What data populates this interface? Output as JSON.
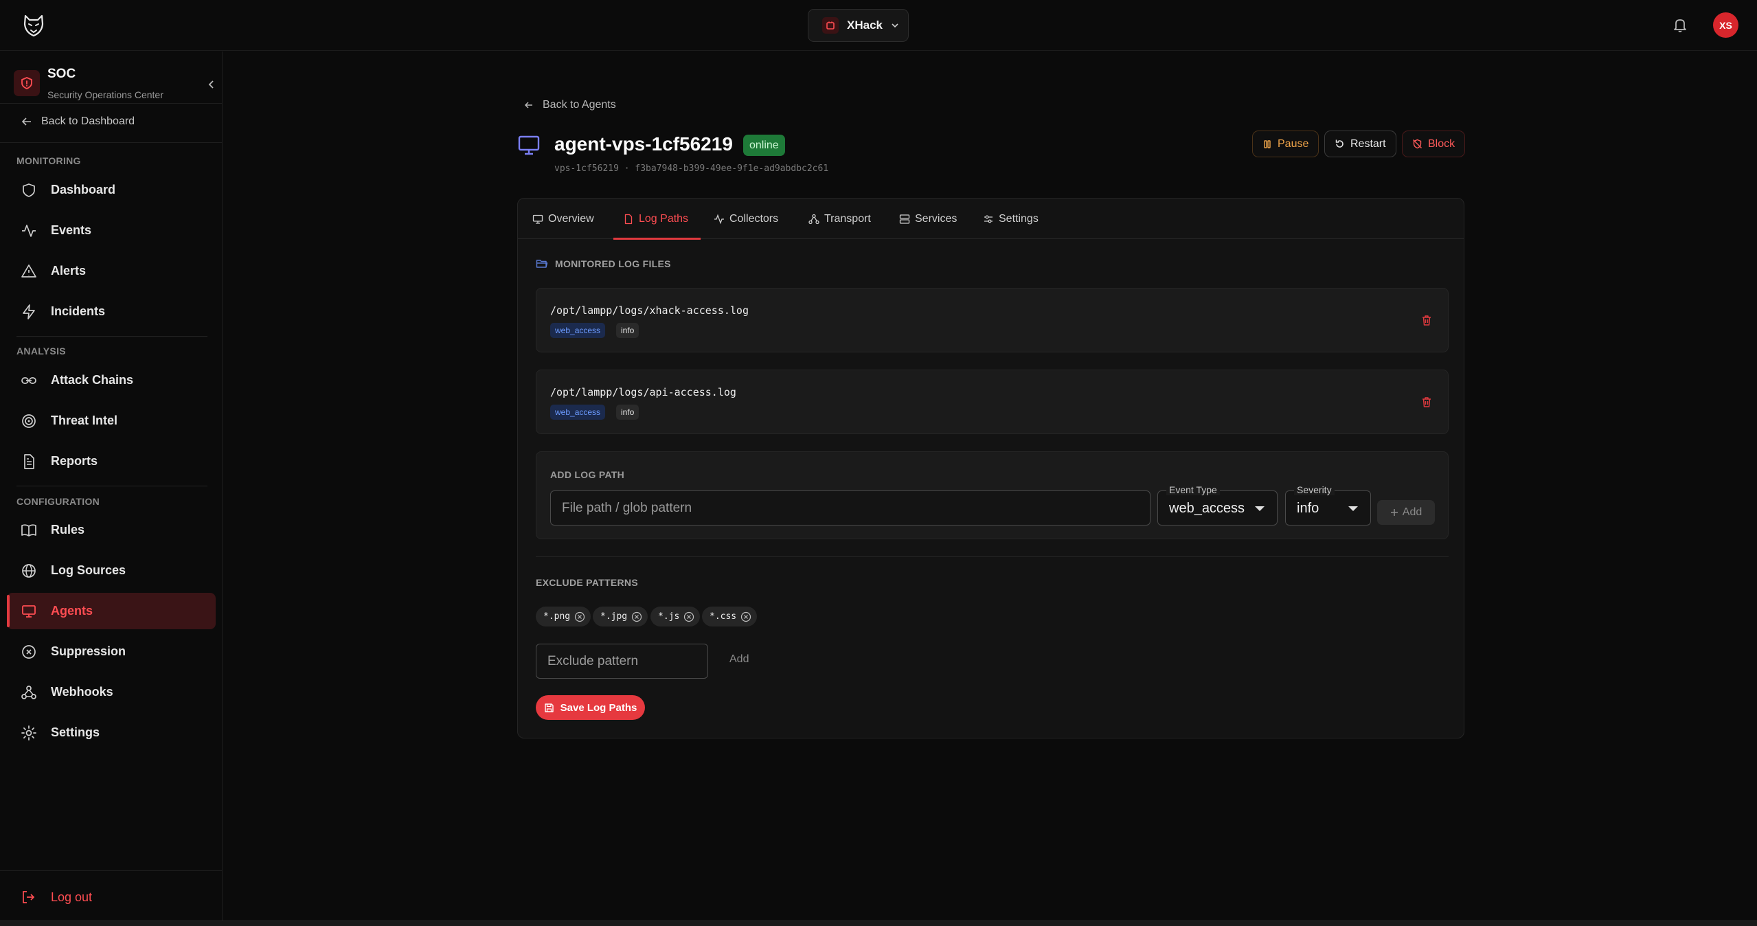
{
  "topbar": {
    "org_name": "XHack",
    "avatar_initials": "XS"
  },
  "sidebar": {
    "soc_title": "SOC",
    "soc_subtitle": "Security Operations Center",
    "back_label": "Back to Dashboard",
    "sections": {
      "monitoring": "MONITORING",
      "analysis": "ANALYSIS",
      "configuration": "CONFIGURATION"
    },
    "items": [
      {
        "label": "Dashboard",
        "icon": "shield-icon"
      },
      {
        "label": "Events",
        "icon": "activity-icon"
      },
      {
        "label": "Alerts",
        "icon": "warning-triangle-icon"
      },
      {
        "label": "Incidents",
        "icon": "zap-icon"
      },
      {
        "label": "Attack Chains",
        "icon": "link-icon"
      },
      {
        "label": "Threat Intel",
        "icon": "target-icon"
      },
      {
        "label": "Reports",
        "icon": "file-text-icon"
      },
      {
        "label": "Rules",
        "icon": "book-icon"
      },
      {
        "label": "Log Sources",
        "icon": "globe-icon"
      },
      {
        "label": "Agents",
        "icon": "monitor-icon",
        "active": true
      },
      {
        "label": "Suppression",
        "icon": "x-circle-icon"
      },
      {
        "label": "Webhooks",
        "icon": "webhook-icon"
      },
      {
        "label": "Settings",
        "icon": "gear-icon"
      }
    ],
    "logout_label": "Log out"
  },
  "agent": {
    "back_label": "Back to Agents",
    "name": "agent-vps-1cf56219",
    "status": "online",
    "ids": "vps-1cf56219 · f3ba7948-b399-49ee-9f1e-ad9abdbc2c61",
    "actions": {
      "pause": "Pause",
      "restart": "Restart",
      "block": "Block"
    }
  },
  "tabs": [
    {
      "label": "Overview",
      "icon": "monitor-icon"
    },
    {
      "label": "Log Paths",
      "icon": "file-icon",
      "active": true
    },
    {
      "label": "Collectors",
      "icon": "activity-icon"
    },
    {
      "label": "Transport",
      "icon": "network-icon"
    },
    {
      "label": "Services",
      "icon": "server-icon"
    },
    {
      "label": "Settings",
      "icon": "sliders-icon"
    }
  ],
  "log_paths": {
    "section_label": "MONITORED LOG FILES",
    "files": [
      {
        "path": "/opt/lampp/logs/xhack-access.log",
        "event_type": "web_access",
        "severity": "info"
      },
      {
        "path": "/opt/lampp/logs/api-access.log",
        "event_type": "web_access",
        "severity": "info"
      }
    ],
    "add": {
      "section_label": "ADD LOG PATH",
      "path_placeholder": "File path / glob pattern",
      "event_type_label": "Event Type",
      "event_type_value": "web_access",
      "severity_label": "Severity",
      "severity_value": "info",
      "add_button": "Add"
    },
    "exclude": {
      "section_label": "EXCLUDE PATTERNS",
      "patterns": [
        "*.png",
        "*.jpg",
        "*.js",
        "*.css"
      ],
      "input_placeholder": "Exclude pattern",
      "add_button": "Add"
    },
    "save_button": "Save Log Paths"
  },
  "colors": {
    "accent": "#e6393f",
    "status_online": "#1e7a38",
    "chip_type": "#6c9bff"
  }
}
